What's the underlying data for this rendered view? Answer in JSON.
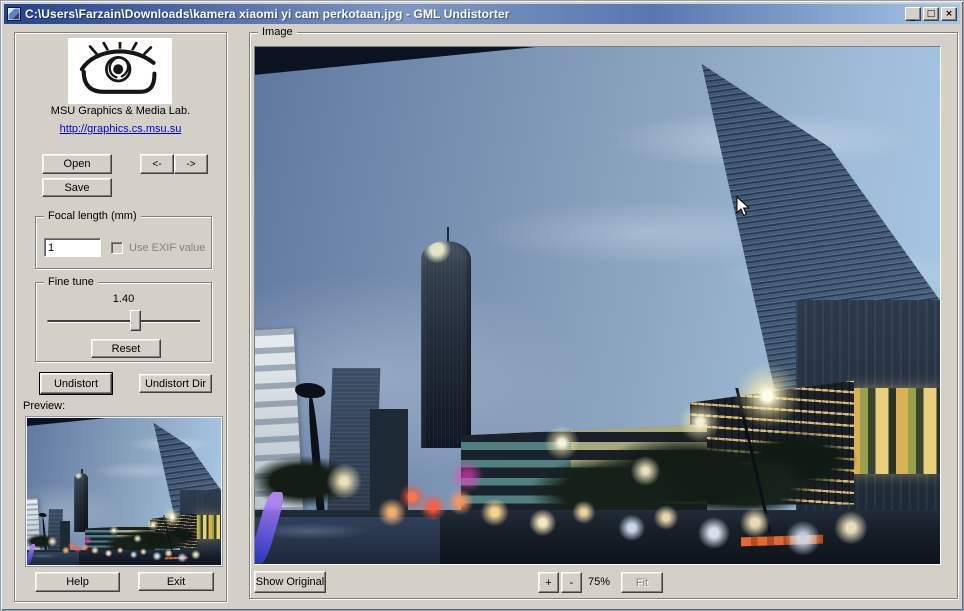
{
  "window": {
    "title": "C:\\Users\\Farzain\\Downloads\\kamera xiaomi yi cam perkotaan.jpg - GML Undistorter",
    "minimize": "_",
    "maximize": "□",
    "close": "×"
  },
  "sidebar": {
    "lab_name": "MSU Graphics & Media Lab.",
    "lab_link": "http://graphics.cs.msu.su",
    "open": "Open",
    "save": "Save",
    "arrow_prev": "<-",
    "arrow_next": "->",
    "focal": {
      "legend": "Focal length (mm)",
      "value": "1",
      "exif_label": "Use EXIF value"
    },
    "fine_tune": {
      "legend": "Fine tune",
      "value": "1.40",
      "reset": "Reset"
    },
    "undistort": "Undistort",
    "undistort_dir": "Undistort Dir",
    "preview_label": "Preview:",
    "help": "Help",
    "exit": "Exit"
  },
  "image_panel": {
    "legend": "Image",
    "show_original": "Show Original",
    "zoom_in": "+",
    "zoom_out": "-",
    "zoom_level": "75%",
    "fit": "Fit"
  },
  "colors": {
    "chrome": "#d4d0c8",
    "titlebar_left": "#25438e",
    "titlebar_right": "#a6c6e8",
    "link": "#0000dd"
  }
}
